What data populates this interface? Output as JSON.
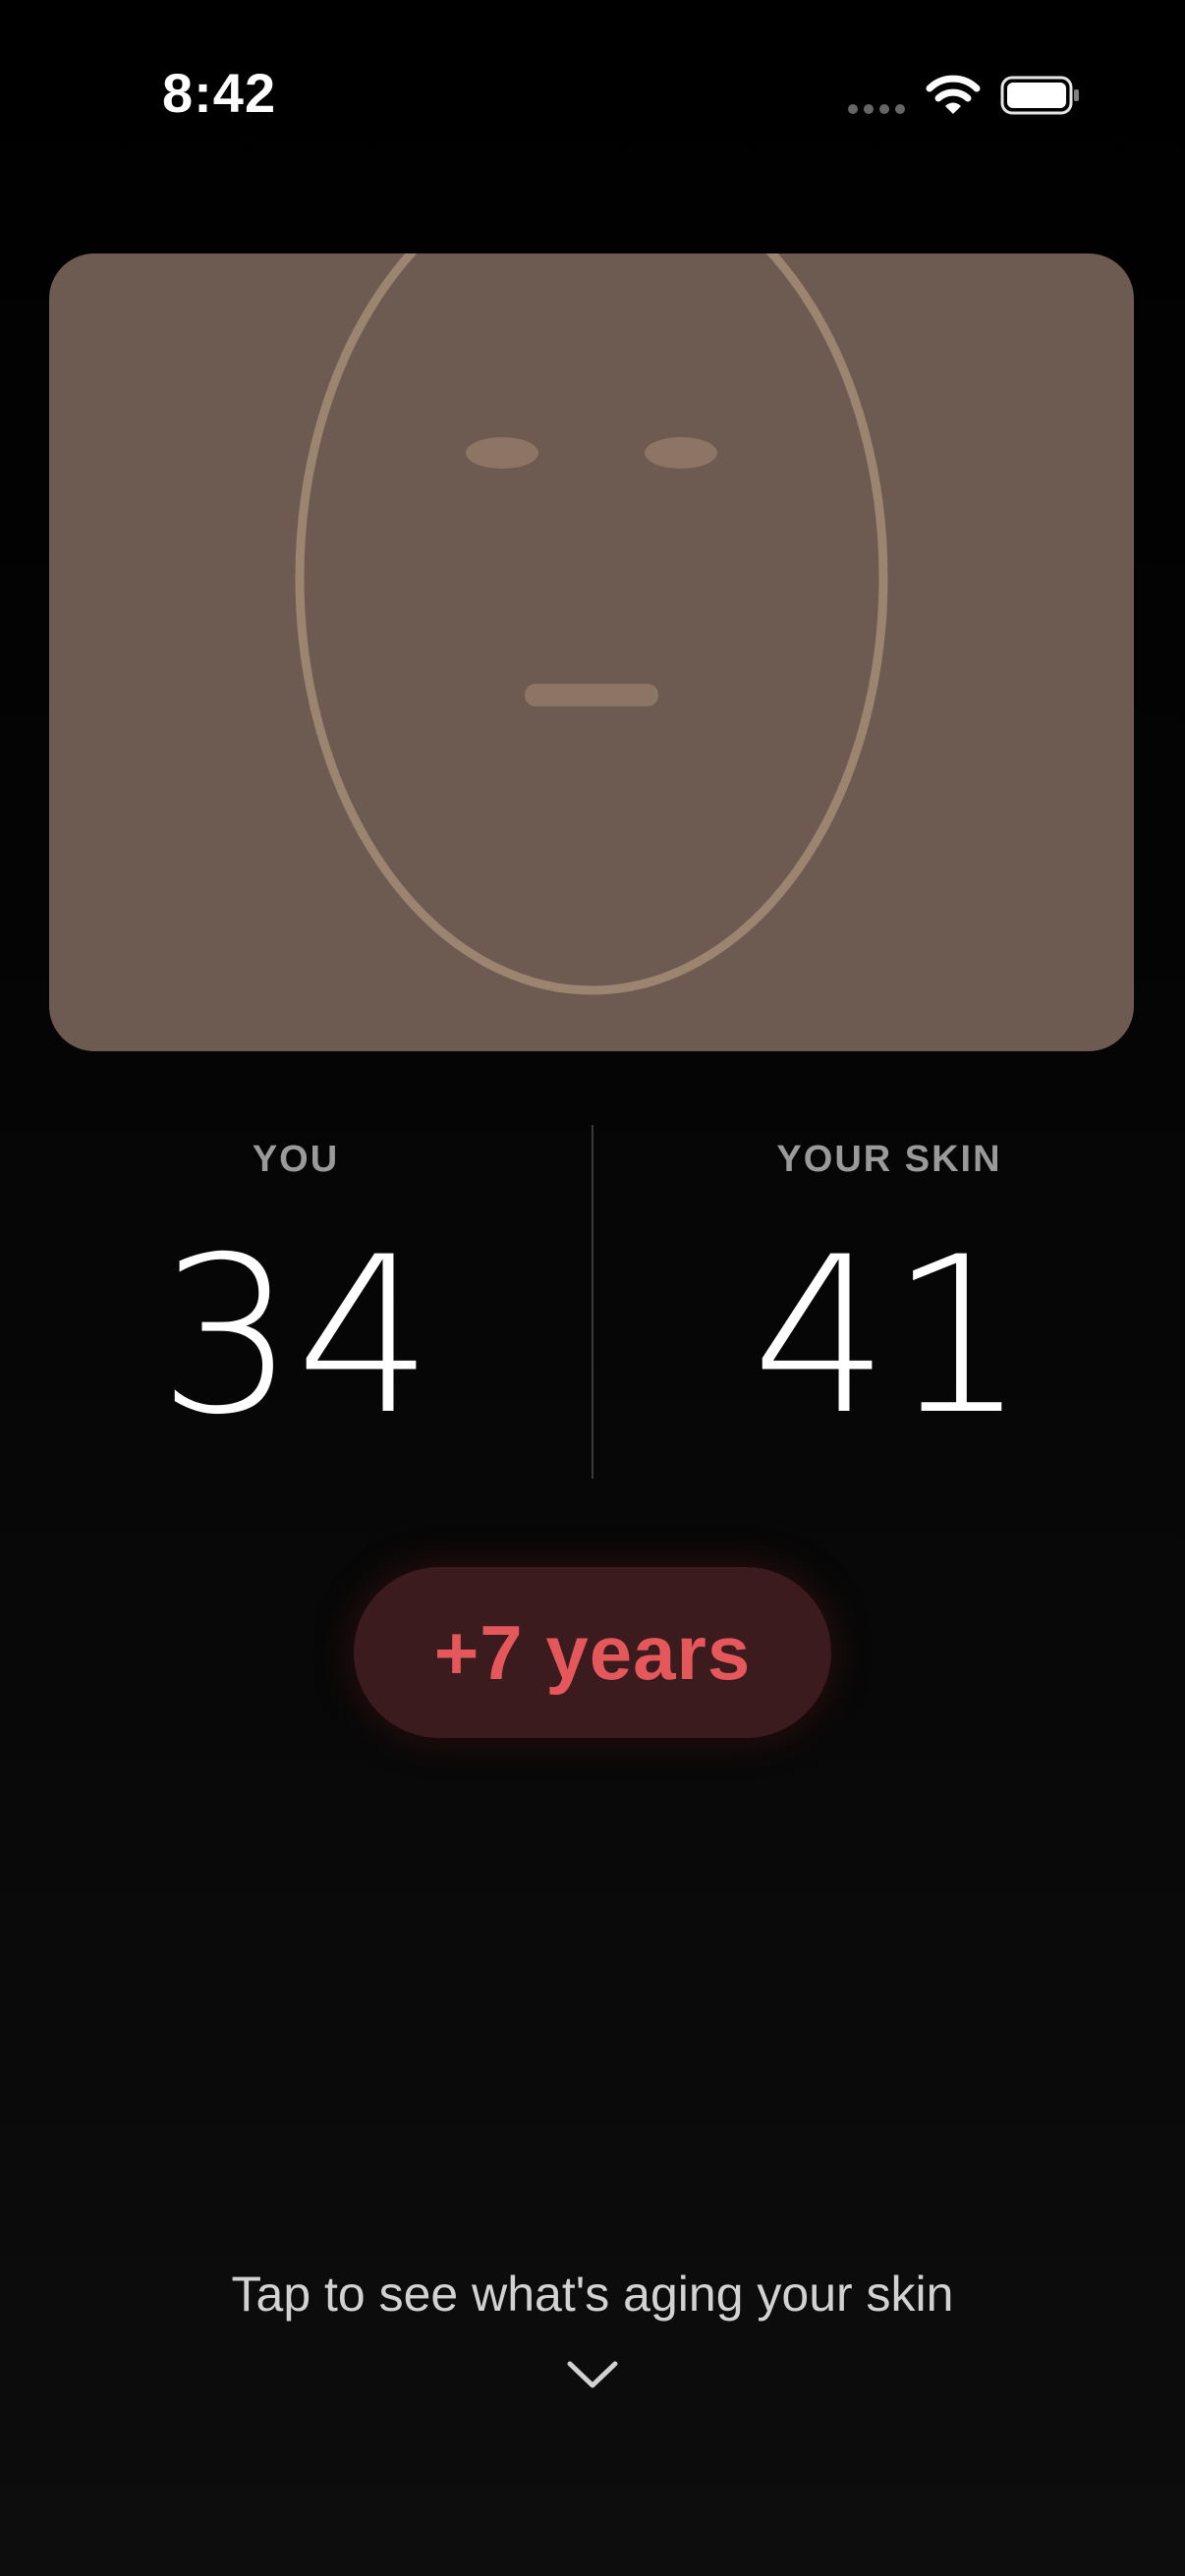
{
  "status_bar": {
    "time": "8:42",
    "icons": [
      "cellular-signal-icon",
      "wifi-icon",
      "battery-icon"
    ]
  },
  "face_preview": {
    "icon": "face-outline-icon",
    "background_color": "#6d5a51",
    "outline_color": "#9b8470"
  },
  "comparison": {
    "you_label": "YOU",
    "you_value": "34",
    "skin_label": "YOUR SKIN",
    "skin_value": "41"
  },
  "delta_badge": {
    "text": "+7 years",
    "color": "#e4575a",
    "background": "#3b1b1d"
  },
  "prompt": {
    "text": "Tap to see what's aging your skin",
    "icon": "chevron-down-icon"
  }
}
